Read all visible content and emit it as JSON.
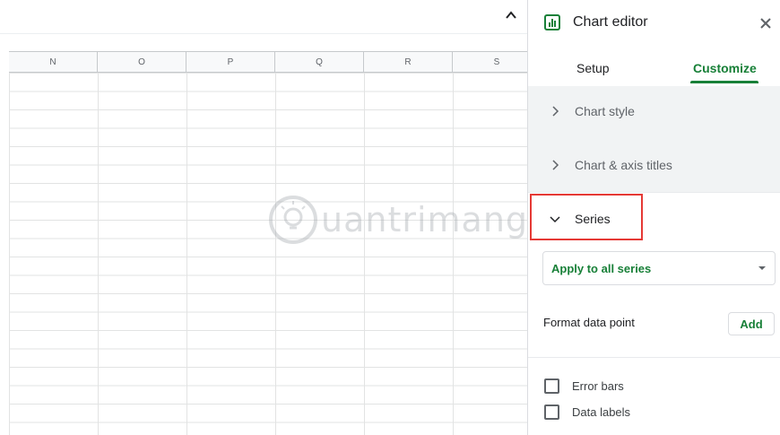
{
  "sheet": {
    "columns": [
      "N",
      "O",
      "P",
      "Q",
      "R",
      "S"
    ],
    "collapse_icon": "chevron-up-icon",
    "watermark_text": "uantrimang"
  },
  "panel": {
    "title": "Chart editor",
    "icon": "chart-icon",
    "close_icon": "close-icon",
    "accent_color": "#188038",
    "tabs": [
      {
        "label": "Setup",
        "active": false
      },
      {
        "label": "Customize",
        "active": true
      }
    ],
    "sections": [
      {
        "label": "Chart style",
        "expanded": false,
        "icon": "chevron-right-icon"
      },
      {
        "label": "Chart & axis titles",
        "expanded": false,
        "icon": "chevron-right-icon"
      },
      {
        "label": "Series",
        "expanded": true,
        "icon": "chevron-down-icon",
        "highlight_color": "#e53935"
      }
    ],
    "series_selector": {
      "value": "Apply to all series",
      "icon": "caret-down-icon"
    },
    "format_data_point": {
      "label": "Format data point",
      "button": "Add"
    },
    "checkboxes": [
      {
        "label": "Error bars",
        "checked": false
      },
      {
        "label": "Data labels",
        "checked": false
      }
    ]
  }
}
